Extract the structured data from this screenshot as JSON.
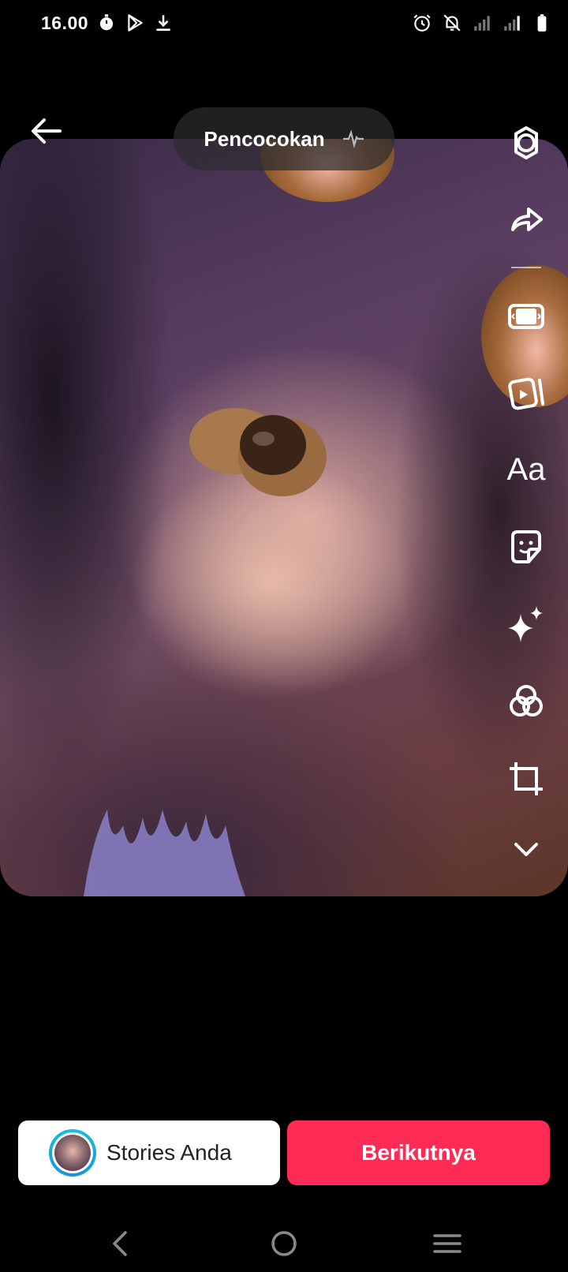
{
  "status_bar": {
    "time": "16.00",
    "left_icons": [
      "timer-icon",
      "play-store-icon",
      "download-icon"
    ],
    "right_icons": [
      "alarm-icon",
      "mute-icon",
      "signal-icon",
      "signal-icon",
      "battery-icon"
    ]
  },
  "editor": {
    "effect_label": "Pencocokan",
    "effect_icon": "waveform-icon",
    "tools": [
      "settings-icon",
      "share-icon",
      "template-icon",
      "video-edit-icon",
      "text-tool",
      "sticker-icon",
      "effects-icon",
      "filters-icon",
      "crop-icon",
      "chevron-down-icon"
    ],
    "text_tool_label": "Aa"
  },
  "bottom_actions": {
    "stories_label": "Stories Anda",
    "next_label": "Berikutnya"
  },
  "colors": {
    "accent": "#fe2c55",
    "story_ring": "#15c3d6"
  }
}
